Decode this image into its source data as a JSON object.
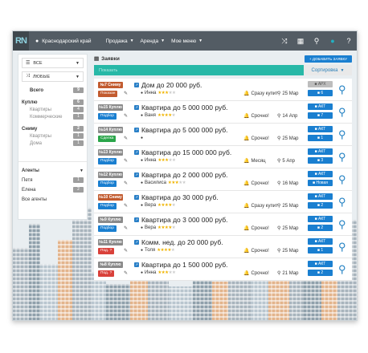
{
  "topbar": {
    "logo": "RN",
    "region": "Краснодарский край",
    "menu": [
      {
        "label": "Продажа"
      },
      {
        "label": "Аренда"
      },
      {
        "label": "Мое меню"
      }
    ]
  },
  "sidebar": {
    "select1": "ВСЕ",
    "select2": "ЛЮБЫЕ",
    "total_label": "Всего",
    "total_count": "9",
    "groups": [
      {
        "label": "Куплю",
        "count": "6",
        "items": [
          {
            "label": "Квартиры",
            "count": "4"
          },
          {
            "label": "Коммерческие",
            "count": "1"
          }
        ]
      },
      {
        "label": "Сниму",
        "count": "2",
        "items": [
          {
            "label": "Квартиры",
            "count": "1"
          },
          {
            "label": "Дома",
            "count": "1"
          }
        ]
      }
    ],
    "agents_label": "Агенты",
    "agents": [
      {
        "label": "Петя",
        "count": "1"
      },
      {
        "label": "Елена",
        "count": "2"
      }
    ],
    "all_agents": "Все агенты"
  },
  "main": {
    "title": "Заявки",
    "add_button": "ДОБАВИТЬ ЗАЯВКУ",
    "filter_placeholder": "Показать",
    "sort_label": "Сортировка"
  },
  "rows": [
    {
      "id": "№7 Сниму",
      "idColor": "#c25b2f",
      "status": "Показан",
      "statusColor": "#c25b2f",
      "title": "Дом до 20 000 руб.",
      "agent": "Инна",
      "stars": 3,
      "metric": "Сразу купит",
      "date": "25 Мар",
      "top": "АРХ",
      "bottom": "6",
      "topGrey": true
    },
    {
      "id": "№15 Куплю",
      "idColor": "#8a8a8a",
      "status": "Подбор",
      "statusColor": "#1a7fd0",
      "title": "Квартира до 5 000 000 руб.",
      "agent": "Ваня",
      "stars": 4,
      "metric": "Срочно!",
      "date": "14 Апр",
      "top": "АКТ",
      "bottom": "7",
      "topGrey": false
    },
    {
      "id": "№14 Куплю",
      "idColor": "#8a8a8a",
      "status": "Сделка",
      "statusColor": "#2aa54a",
      "title": "Квартира до 5 000 000 руб.",
      "agent": "",
      "stars": 0,
      "metric": "Срочно!",
      "date": "25 Мар",
      "top": "АКТ",
      "bottom": "1",
      "topGrey": false
    },
    {
      "id": "№13 Куплю",
      "idColor": "#8a8a8a",
      "status": "Подбор",
      "statusColor": "#1a7fd0",
      "title": "Квартира до 15 000 000 руб.",
      "agent": "Инна",
      "stars": 3,
      "metric": "Месяц",
      "date": "5 Апр",
      "top": "АКТ",
      "bottom": "3",
      "topGrey": false
    },
    {
      "id": "№12 Куплю",
      "idColor": "#8a8a8a",
      "status": "Подбор",
      "statusColor": "#1a7fd0",
      "title": "Квартира до 2 000 000 руб.",
      "agent": "Василиса",
      "stars": 3,
      "metric": "Срочно!",
      "date": "16 Мар",
      "top": "АКТ",
      "bottom": "Новая",
      "topGrey": false
    },
    {
      "id": "№10 Сниму",
      "idColor": "#c25b2f",
      "status": "Подбор",
      "statusColor": "#1a7fd0",
      "title": "Квартира до 30 000 руб.",
      "agent": "Вера",
      "stars": 4,
      "metric": "Сразу купит",
      "date": "25 Мар",
      "top": "АКТ",
      "bottom": "2",
      "topGrey": false
    },
    {
      "id": "№9 Куплю",
      "idColor": "#8a8a8a",
      "status": "Подбор",
      "statusColor": "#1a7fd0",
      "title": "Квартира до 3 000 000 руб.",
      "agent": "Вера",
      "stars": 4,
      "metric": "Срочно!",
      "date": "25 Мар",
      "top": "АКТ",
      "bottom": "2",
      "topGrey": false
    },
    {
      "id": "№11 Куплю",
      "idColor": "#8a8a8a",
      "status": "Под. ?",
      "statusColor": "#d9413a",
      "title": "Комм. нед. до 20 000 руб.",
      "agent": "Толя",
      "stars": 4,
      "metric": "Срочно!",
      "date": "25 Мар",
      "top": "АКТ",
      "bottom": "1",
      "topGrey": false
    },
    {
      "id": "№8 Куплю",
      "idColor": "#8a8a8a",
      "status": "Под. ?",
      "statusColor": "#d9413a",
      "title": "Квартира до 1 500 000 руб.",
      "agent": "Инна",
      "stars": 3,
      "metric": "Срочно!",
      "date": "21 Мар",
      "top": "АКТ",
      "bottom": "2",
      "topGrey": false
    }
  ]
}
